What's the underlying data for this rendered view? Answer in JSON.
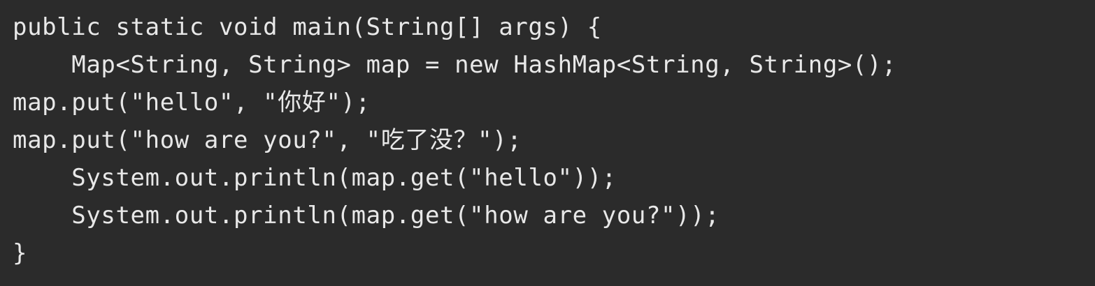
{
  "code": {
    "language": "Java",
    "background": "#2b2b2b",
    "text_color": "#e8e8e8",
    "lines": [
      "public static void main(String[] args) {",
      "    Map<String, String> map = new HashMap<String, String>();",
      "map.put(\"hello\", \"你好\");",
      "map.put(\"how are you?\", \"吃了没？\");",
      "    System.out.println(map.get(\"hello\"));",
      "    System.out.println(map.get(\"how are you?\"));",
      "}"
    ]
  }
}
